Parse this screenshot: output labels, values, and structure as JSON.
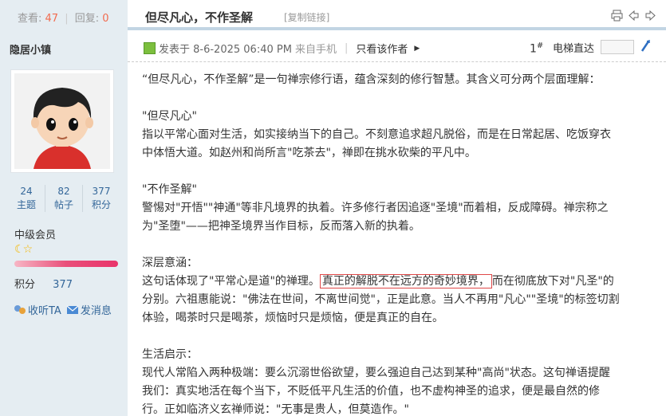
{
  "stats": {
    "views_label": "查看:",
    "views": "47",
    "replies_label": "回复:",
    "replies": "0"
  },
  "thread": {
    "title": "但尽凡心，不作圣解",
    "copy_link": "[复制链接]"
  },
  "author": {
    "name": "隐居小镇",
    "stats": [
      {
        "value": "24",
        "label": "主题"
      },
      {
        "value": "82",
        "label": "帖子"
      },
      {
        "value": "377",
        "label": "积分"
      }
    ],
    "level": "中级会员",
    "score_label": "积分",
    "score": "377",
    "listen": "收听TA",
    "message": "发消息"
  },
  "post": {
    "posted": "发表于 8-6-2025 06:40 PM",
    "source": "来自手机",
    "only_author": "只看该作者",
    "floor": "1",
    "floor_mark": "#",
    "elevator": "电梯直达"
  },
  "content": {
    "intro": "“但尽凡心，不作圣解”是一句禅宗修行语，蕴含深刻的修行智慧。其含义可分两个层面理解：",
    "s1_title": "\"但尽凡心\"",
    "s1_l1": "指以平常心面对生活，如实接纳当下的自己。不刻意追求超凡脱俗，而是在日常起居、吃饭穿衣",
    "s1_l2": "中体悟大道。如赵州和尚所言\"吃茶去\"，禅即在挑水砍柴的平凡中。",
    "s2_title": "\"不作圣解\"",
    "s2_l1": "警惕对\"开悟\"\"神通\"等非凡境界的执着。许多修行者因追逐\"圣境\"而着相，反成障碍。禅宗称之",
    "s2_l2": "为\"圣堕\"——把神圣境界当作目标，反而落入新的执着。",
    "s3_title": "深层意涵：",
    "s3_l1a": "这句话体现了\"平常心是道\"的禅理。",
    "s3_hl": "真正的解脱不在远方的奇妙境界，",
    "s3_l1b": "而在彻底放下对\"凡圣\"的",
    "s3_l2": "分别。六祖惠能说：\"佛法在世间，不离世间觉\"，正是此意。当人不再用\"凡心\"\"圣境\"的标签切割",
    "s3_l3": "体验，喝茶时只是喝茶，烦恼时只是烦恼，便是真正的自在。",
    "s4_title": "生活启示：",
    "s4_l1": "现代人常陷入两种极端：要么沉溺世俗欲望，要么强迫自己达到某种\"高尚\"状态。这句禅语提醒",
    "s4_l2": "我们：真实地活在每个当下，不贬低平凡生活的价值，也不虚构神圣的追求，便是最自然的修",
    "s4_l3": "行。正如临济义玄禅师说：\"无事是贵人，但莫造作。\""
  }
}
